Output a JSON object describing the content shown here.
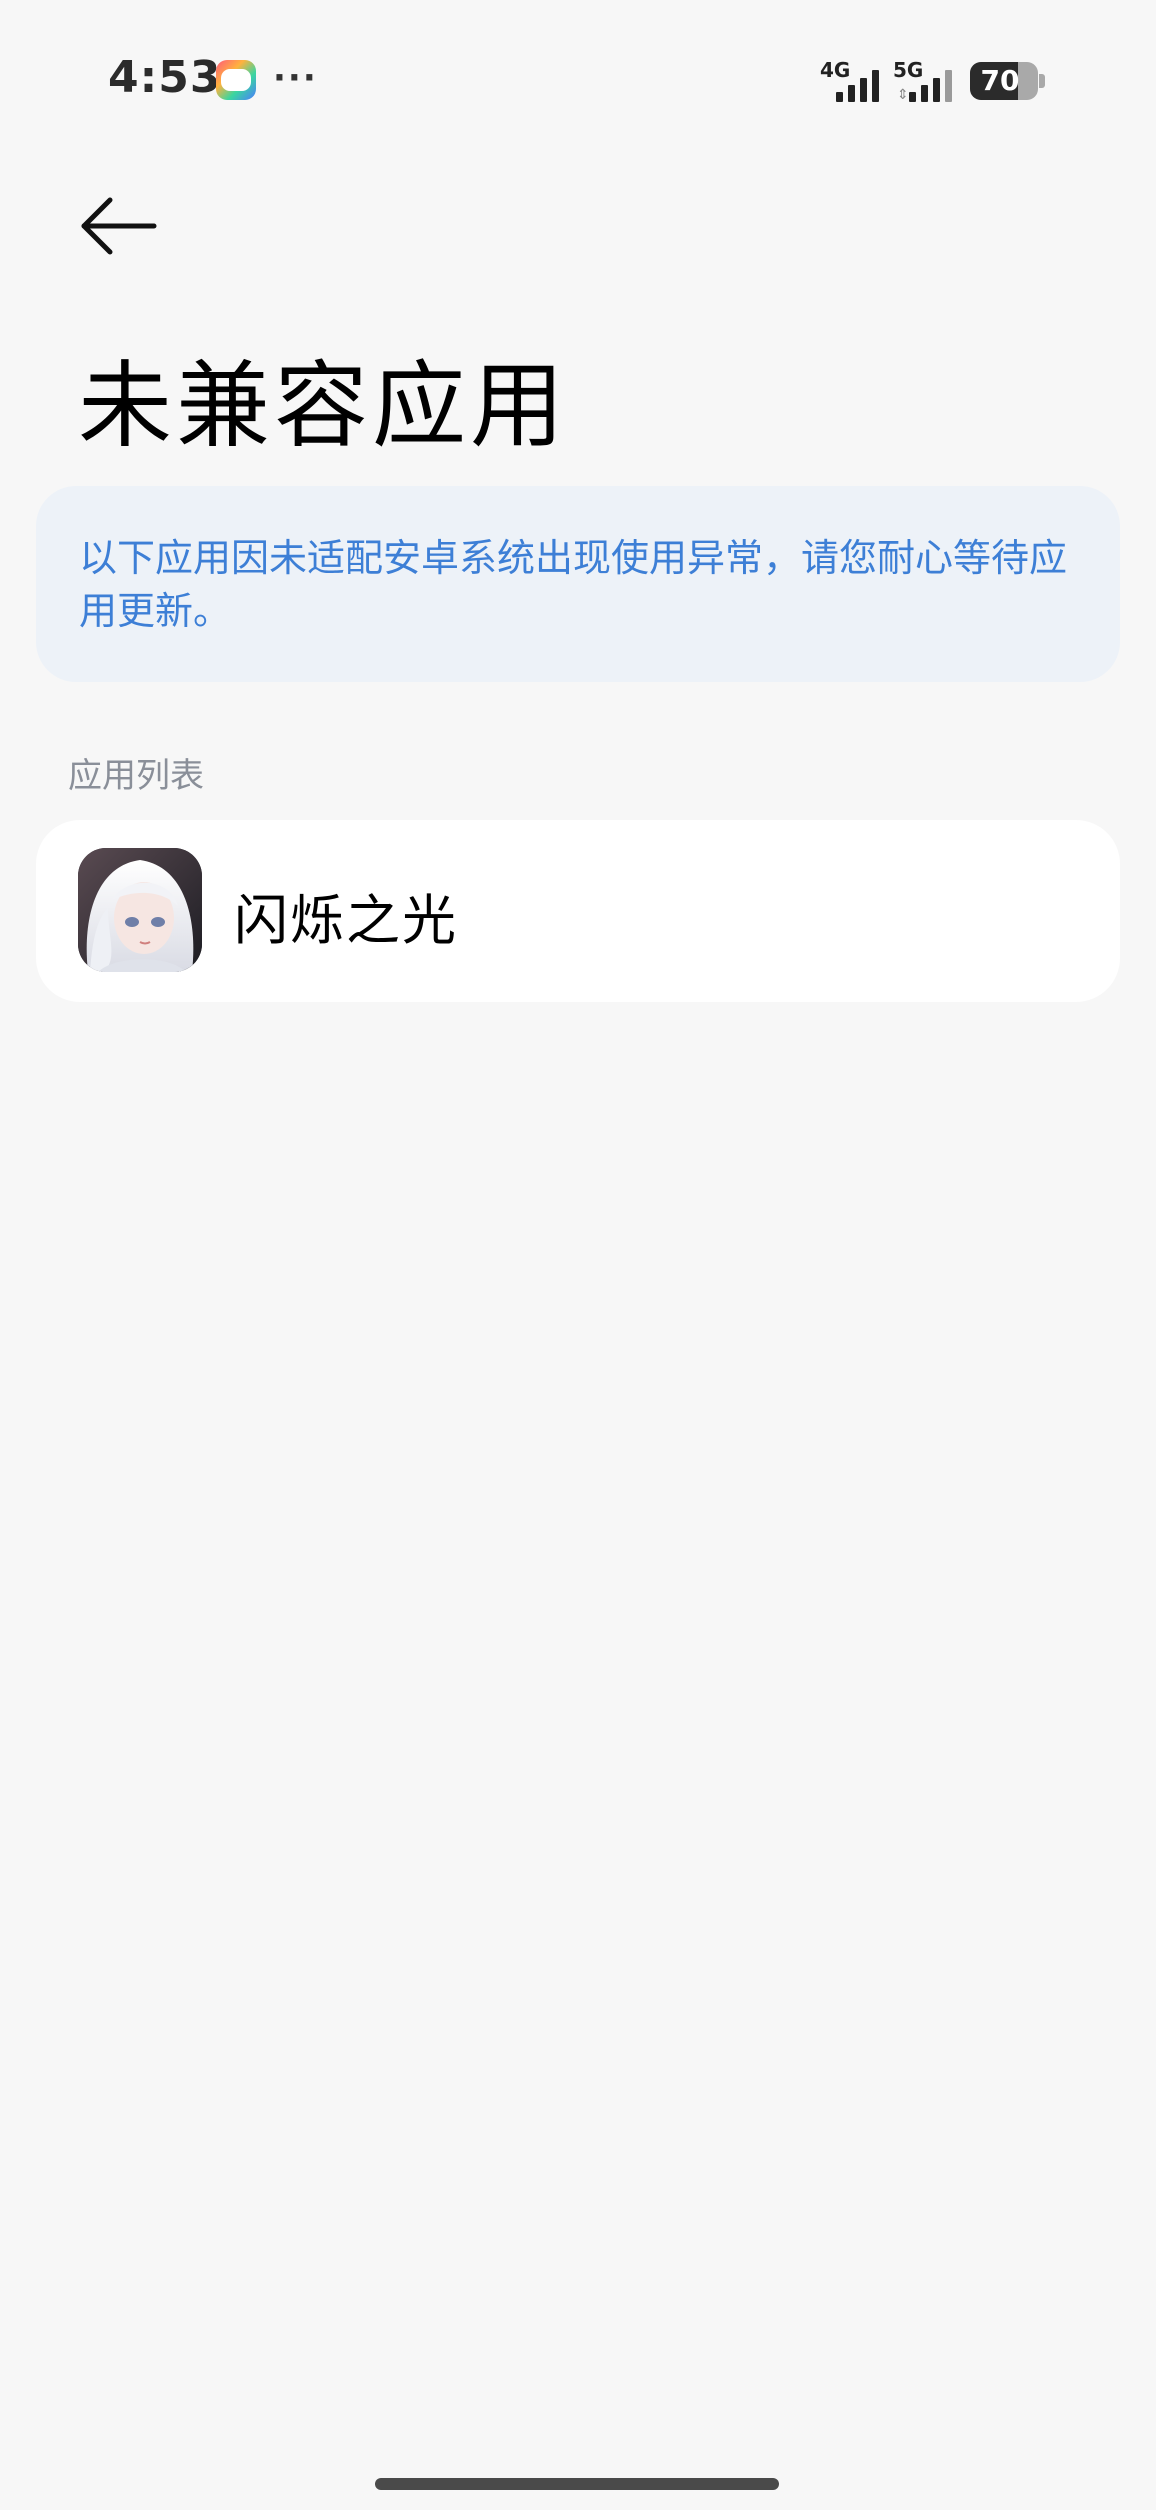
{
  "status_bar": {
    "time": "4:53",
    "more": "···",
    "signal_1_label": "4G",
    "signal_2_label": "5G",
    "battery_level": "70",
    "battery_fraction": 0.7
  },
  "header": {
    "back_icon": "arrow-left-icon",
    "title": "未兼容应用"
  },
  "notice": {
    "text": "以下应用因未适配安卓系统出现使用异常，请您耐心等待应用更新。"
  },
  "section": {
    "label": "应用列表"
  },
  "apps": [
    {
      "name": "闪烁之光",
      "icon": "anime-character-app-icon"
    }
  ],
  "colors": {
    "background": "#f7f7f7",
    "notice_bg": "#edf2f8",
    "notice_text": "#3d7fd6",
    "section_label": "#8a8f99",
    "card_bg": "#ffffff"
  }
}
